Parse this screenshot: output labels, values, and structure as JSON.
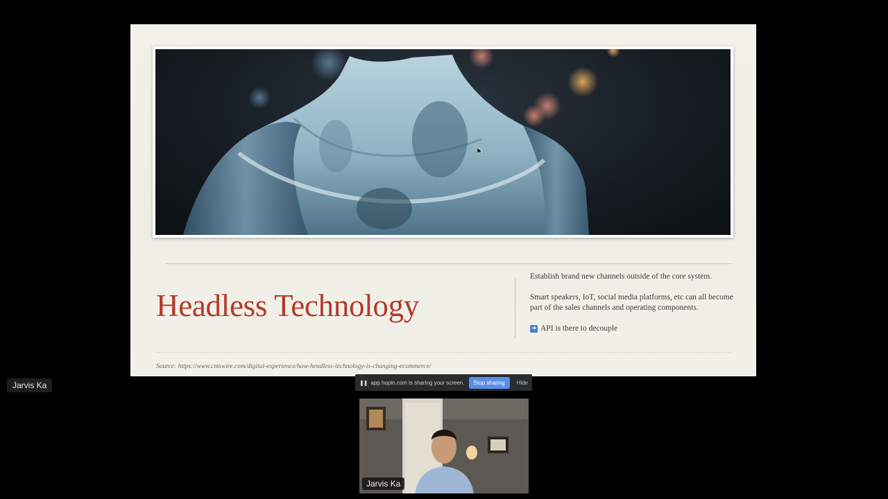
{
  "slide": {
    "title": "Headless Technology",
    "points": [
      "Establish brand new channels outside of the core system.",
      "Smart speakers, IoT, social media platforms, etc can all become part of the sales channels and operating components."
    ],
    "api_note": "API is there to decouple",
    "api_icon": "right-arrow-icon",
    "source": "Source: https://www.cmswire.com/digital-experience/how-headless-technology-is-changing-ecommerce/"
  },
  "participants": {
    "left_tag": "Jarvis Ka",
    "webcam_tag": "Jarvis Ka"
  },
  "share_bar": {
    "pause_icon": "pause-icon",
    "message": "app.hopin.com is sharing your screen.",
    "stop_label": "Stop sharing",
    "hide_label": "Hide"
  },
  "colors": {
    "title": "#b23a2c",
    "stop_button": "#5a8ee6"
  }
}
